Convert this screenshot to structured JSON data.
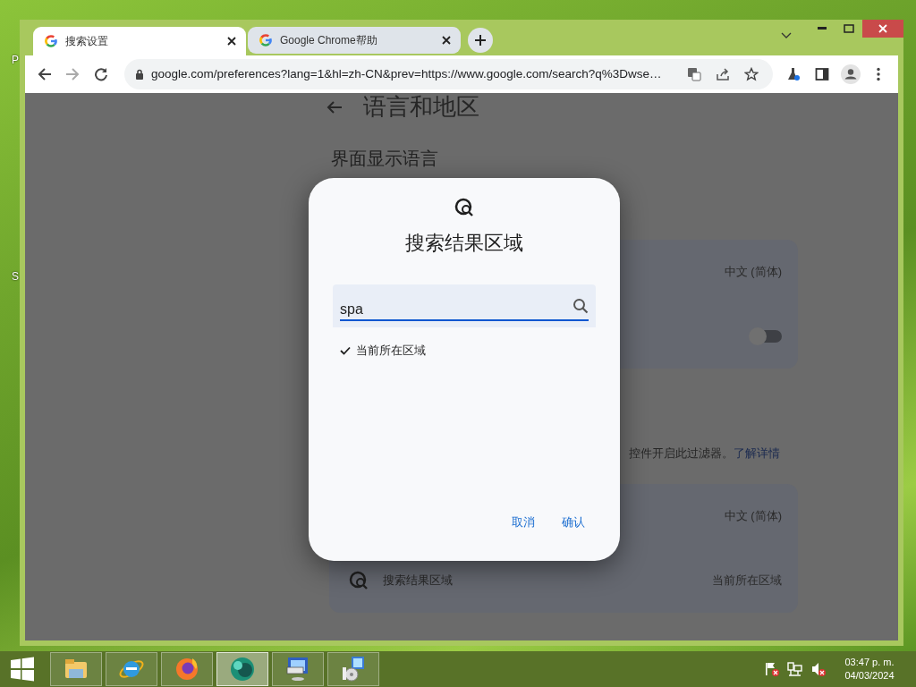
{
  "desktop_labels": [
    "P",
    "S"
  ],
  "browser": {
    "tabs": [
      {
        "title": "搜索设置",
        "selected": true
      },
      {
        "title": "Google Chrome帮助",
        "selected": false
      }
    ],
    "url": "google.com/preferences?lang=1&hl=zh-CN&prev=https://www.google.com/search?q%3Dwse…"
  },
  "page": {
    "title": "语言和地区",
    "section_title": "界面显示语言",
    "card1": {
      "value": "中文 (简体)",
      "toggle_on": false
    },
    "note": "控件开启此过滤器。",
    "note_link": "了解详情",
    "card2": {
      "rows": [
        {
          "value": "中文 (简体)"
        },
        {
          "label": "搜索结果区域",
          "value": "当前所在区域"
        }
      ]
    }
  },
  "dialog": {
    "title": "搜索结果区域",
    "search_value": "spa",
    "options": [
      {
        "label": "当前所在区域",
        "selected": true
      }
    ],
    "buttons": [
      "取消",
      "确认"
    ]
  },
  "taskbar": {
    "apps": [
      {
        "kind": "folder",
        "selected": false
      },
      {
        "kind": "ie",
        "selected": false
      },
      {
        "kind": "firefox",
        "selected": false
      },
      {
        "kind": "orb",
        "selected": true
      },
      {
        "kind": "keyboard",
        "selected": false
      },
      {
        "kind": "installer",
        "selected": false
      }
    ],
    "time": "03:47 p. m.",
    "date": "04/03/2024"
  }
}
